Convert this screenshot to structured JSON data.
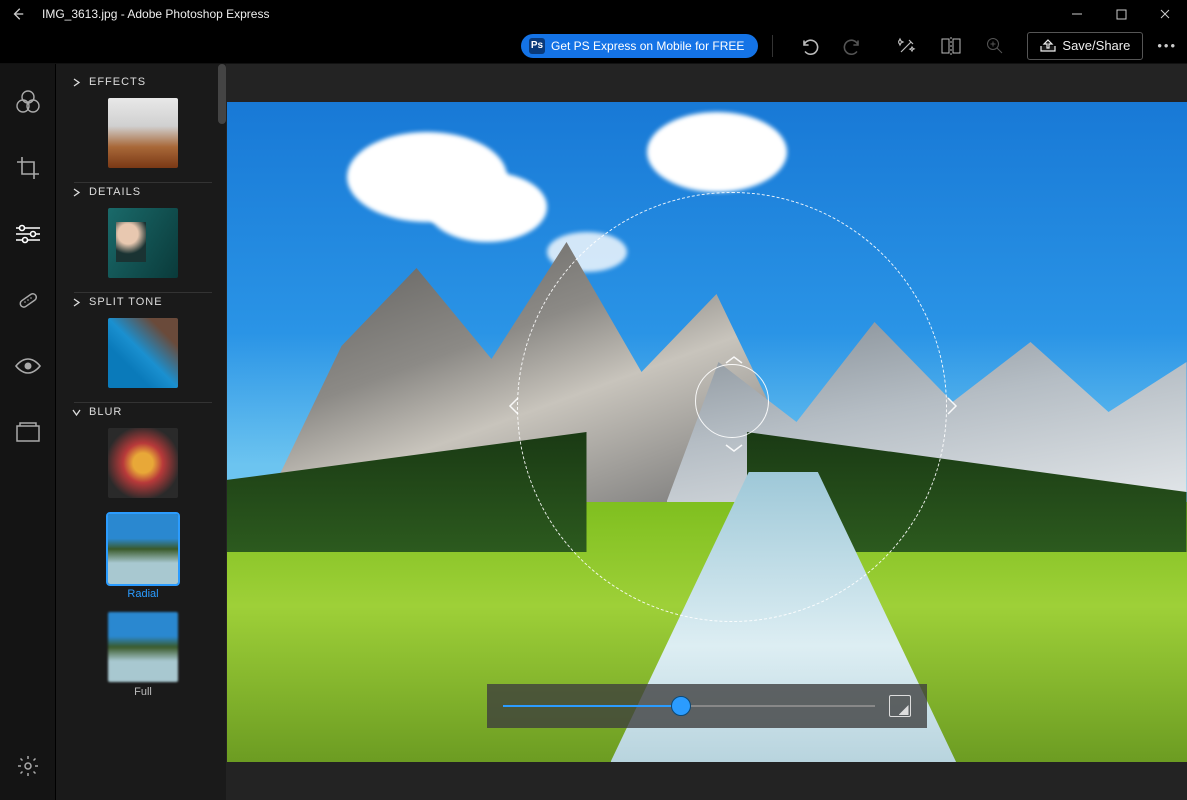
{
  "titlebar": {
    "title": "IMG_3613.jpg - Adobe Photoshop Express"
  },
  "topbar": {
    "promo": "Get PS Express on Mobile for FREE",
    "save_label": "Save/Share"
  },
  "panel": {
    "sections": {
      "effects": {
        "label": "EFFECTS"
      },
      "details": {
        "label": "DETAILS"
      },
      "splittone": {
        "label": "SPLIT TONE"
      },
      "blur": {
        "label": "BLUR"
      }
    },
    "blur_items": {
      "radial": {
        "label": "Radial"
      },
      "full": {
        "label": "Full"
      }
    }
  }
}
